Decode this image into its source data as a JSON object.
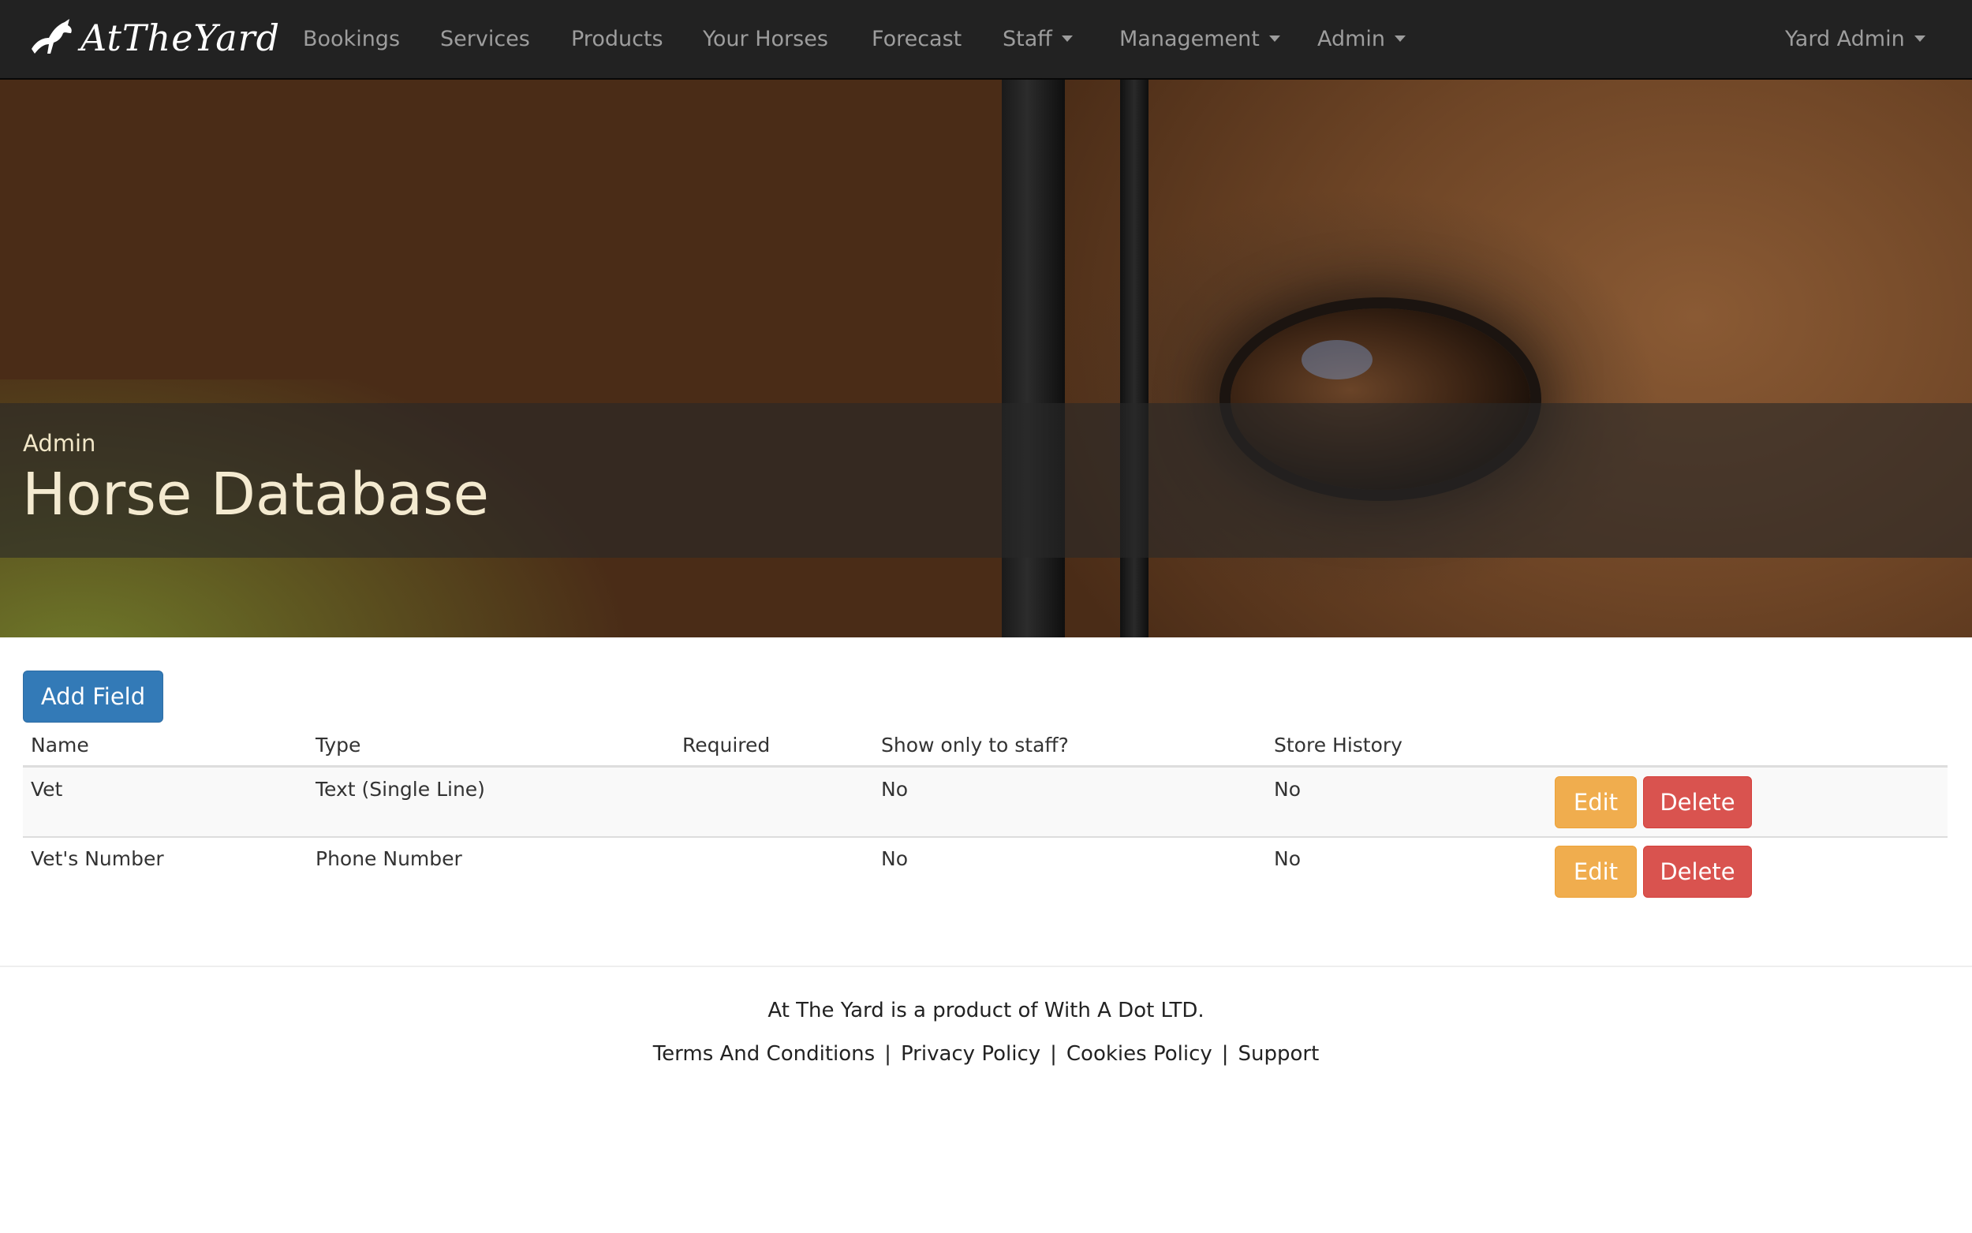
{
  "navbar": {
    "brand": "AtTheYard",
    "items": [
      {
        "label": "Bookings"
      },
      {
        "label": "Services"
      },
      {
        "label": "Products"
      },
      {
        "label": "Your Horses"
      },
      {
        "label": "Forecast"
      },
      {
        "label": "Staff",
        "dropdown": true
      },
      {
        "label": "Management",
        "dropdown": true
      },
      {
        "label": "Admin",
        "dropdown": true
      }
    ],
    "user": {
      "label": "Yard Admin",
      "dropdown": true
    }
  },
  "hero": {
    "subtitle": "Admin",
    "title": "Horse Database"
  },
  "toolbar": {
    "add_label": "Add Field"
  },
  "table": {
    "headers": [
      "Name",
      "Type",
      "Required",
      "Show only to staff?",
      "Store History"
    ],
    "rows": [
      {
        "name": "Vet",
        "type": "Text (Single Line)",
        "required": "",
        "staff_only": "No",
        "store_history": "No",
        "edit": "Edit",
        "delete": "Delete"
      },
      {
        "name": "Vet's Number",
        "type": "Phone Number",
        "required": "",
        "staff_only": "No",
        "store_history": "No",
        "edit": "Edit",
        "delete": "Delete"
      }
    ]
  },
  "footer": {
    "text": "At The Yard is a product of With A Dot LTD.",
    "links": [
      "Terms And Conditions",
      "Privacy Policy",
      "Cookies Policy",
      "Support"
    ],
    "separator": "|"
  },
  "colors": {
    "navbar_bg": "#222222",
    "primary": "#337ab7",
    "warning": "#f0ad4e",
    "danger": "#d9534f"
  }
}
